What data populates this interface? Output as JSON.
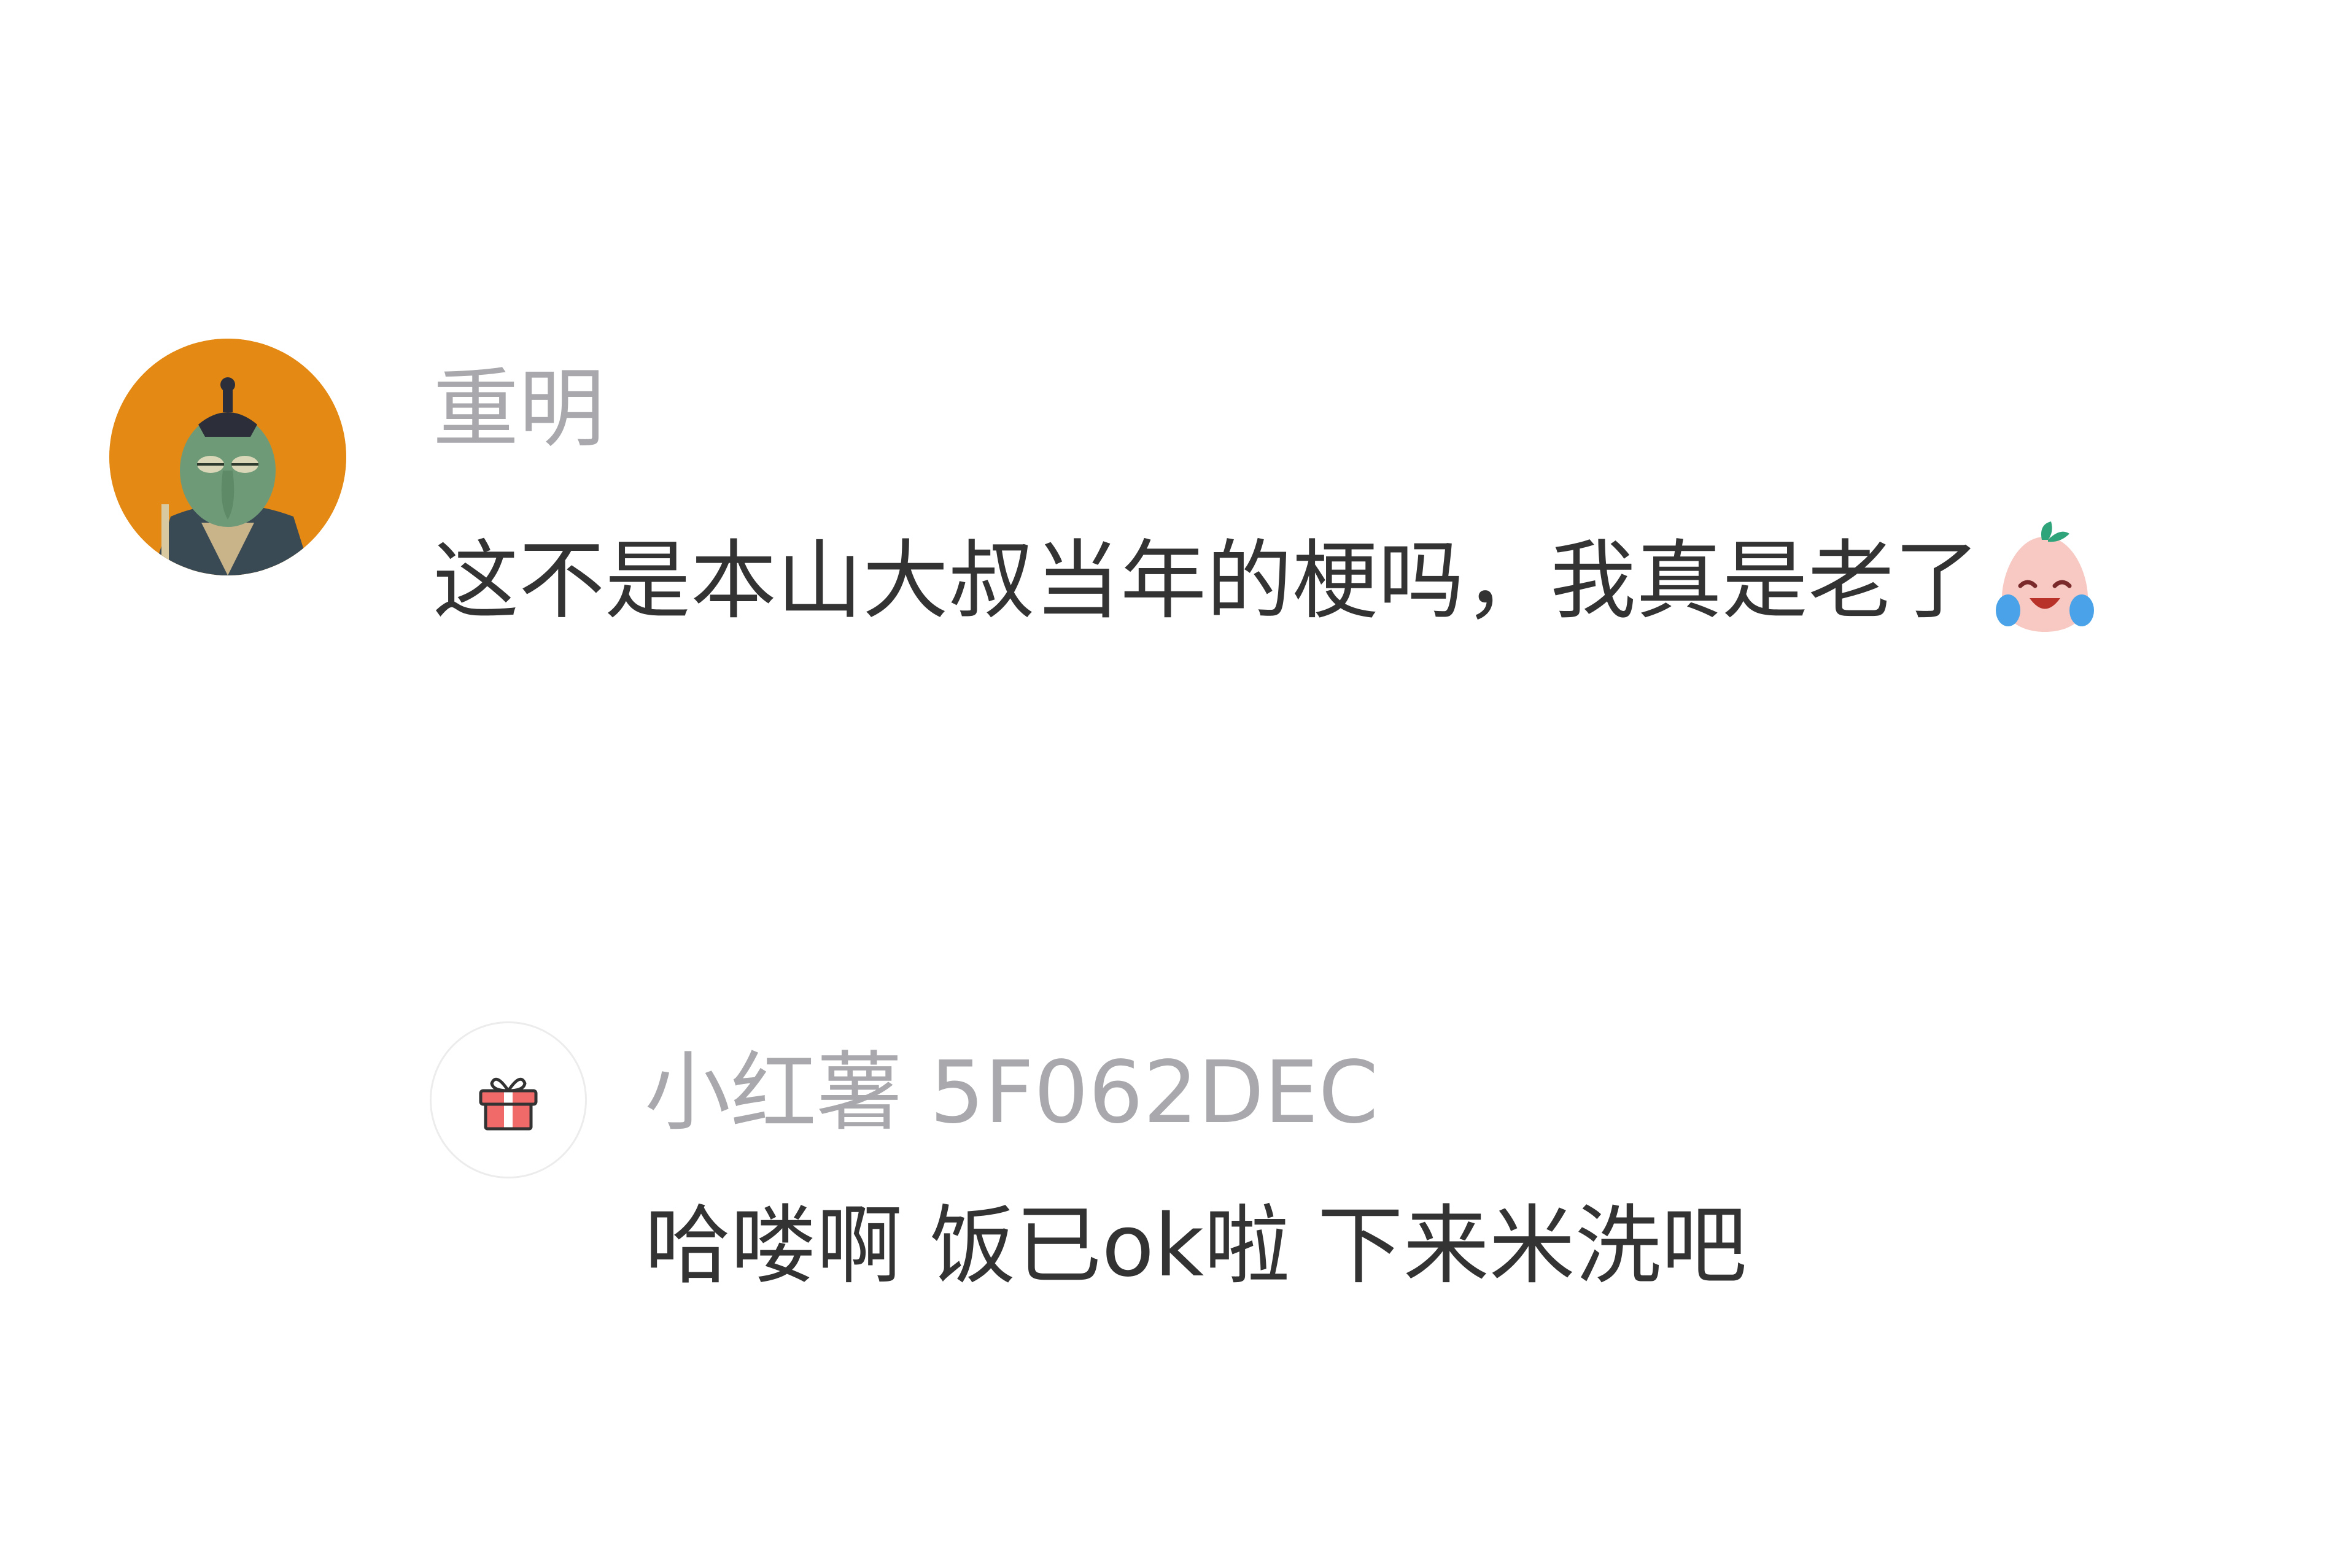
{
  "comments": [
    {
      "username": "重明",
      "text": "这不是本山大叔当年的梗吗，我真是老了",
      "emoji": "laughing-crying-emoji",
      "avatar": "squidward-portrait-avatar",
      "avatar_bg": "#e48a14"
    }
  ],
  "reply": {
    "username": "小红薯 5F062DEC",
    "text": "哈喽啊 饭已ok啦 下来米洗吧",
    "avatar": "gift-icon"
  },
  "colors": {
    "username": "#a9a9ad",
    "text": "#333333",
    "background": "#ffffff"
  }
}
